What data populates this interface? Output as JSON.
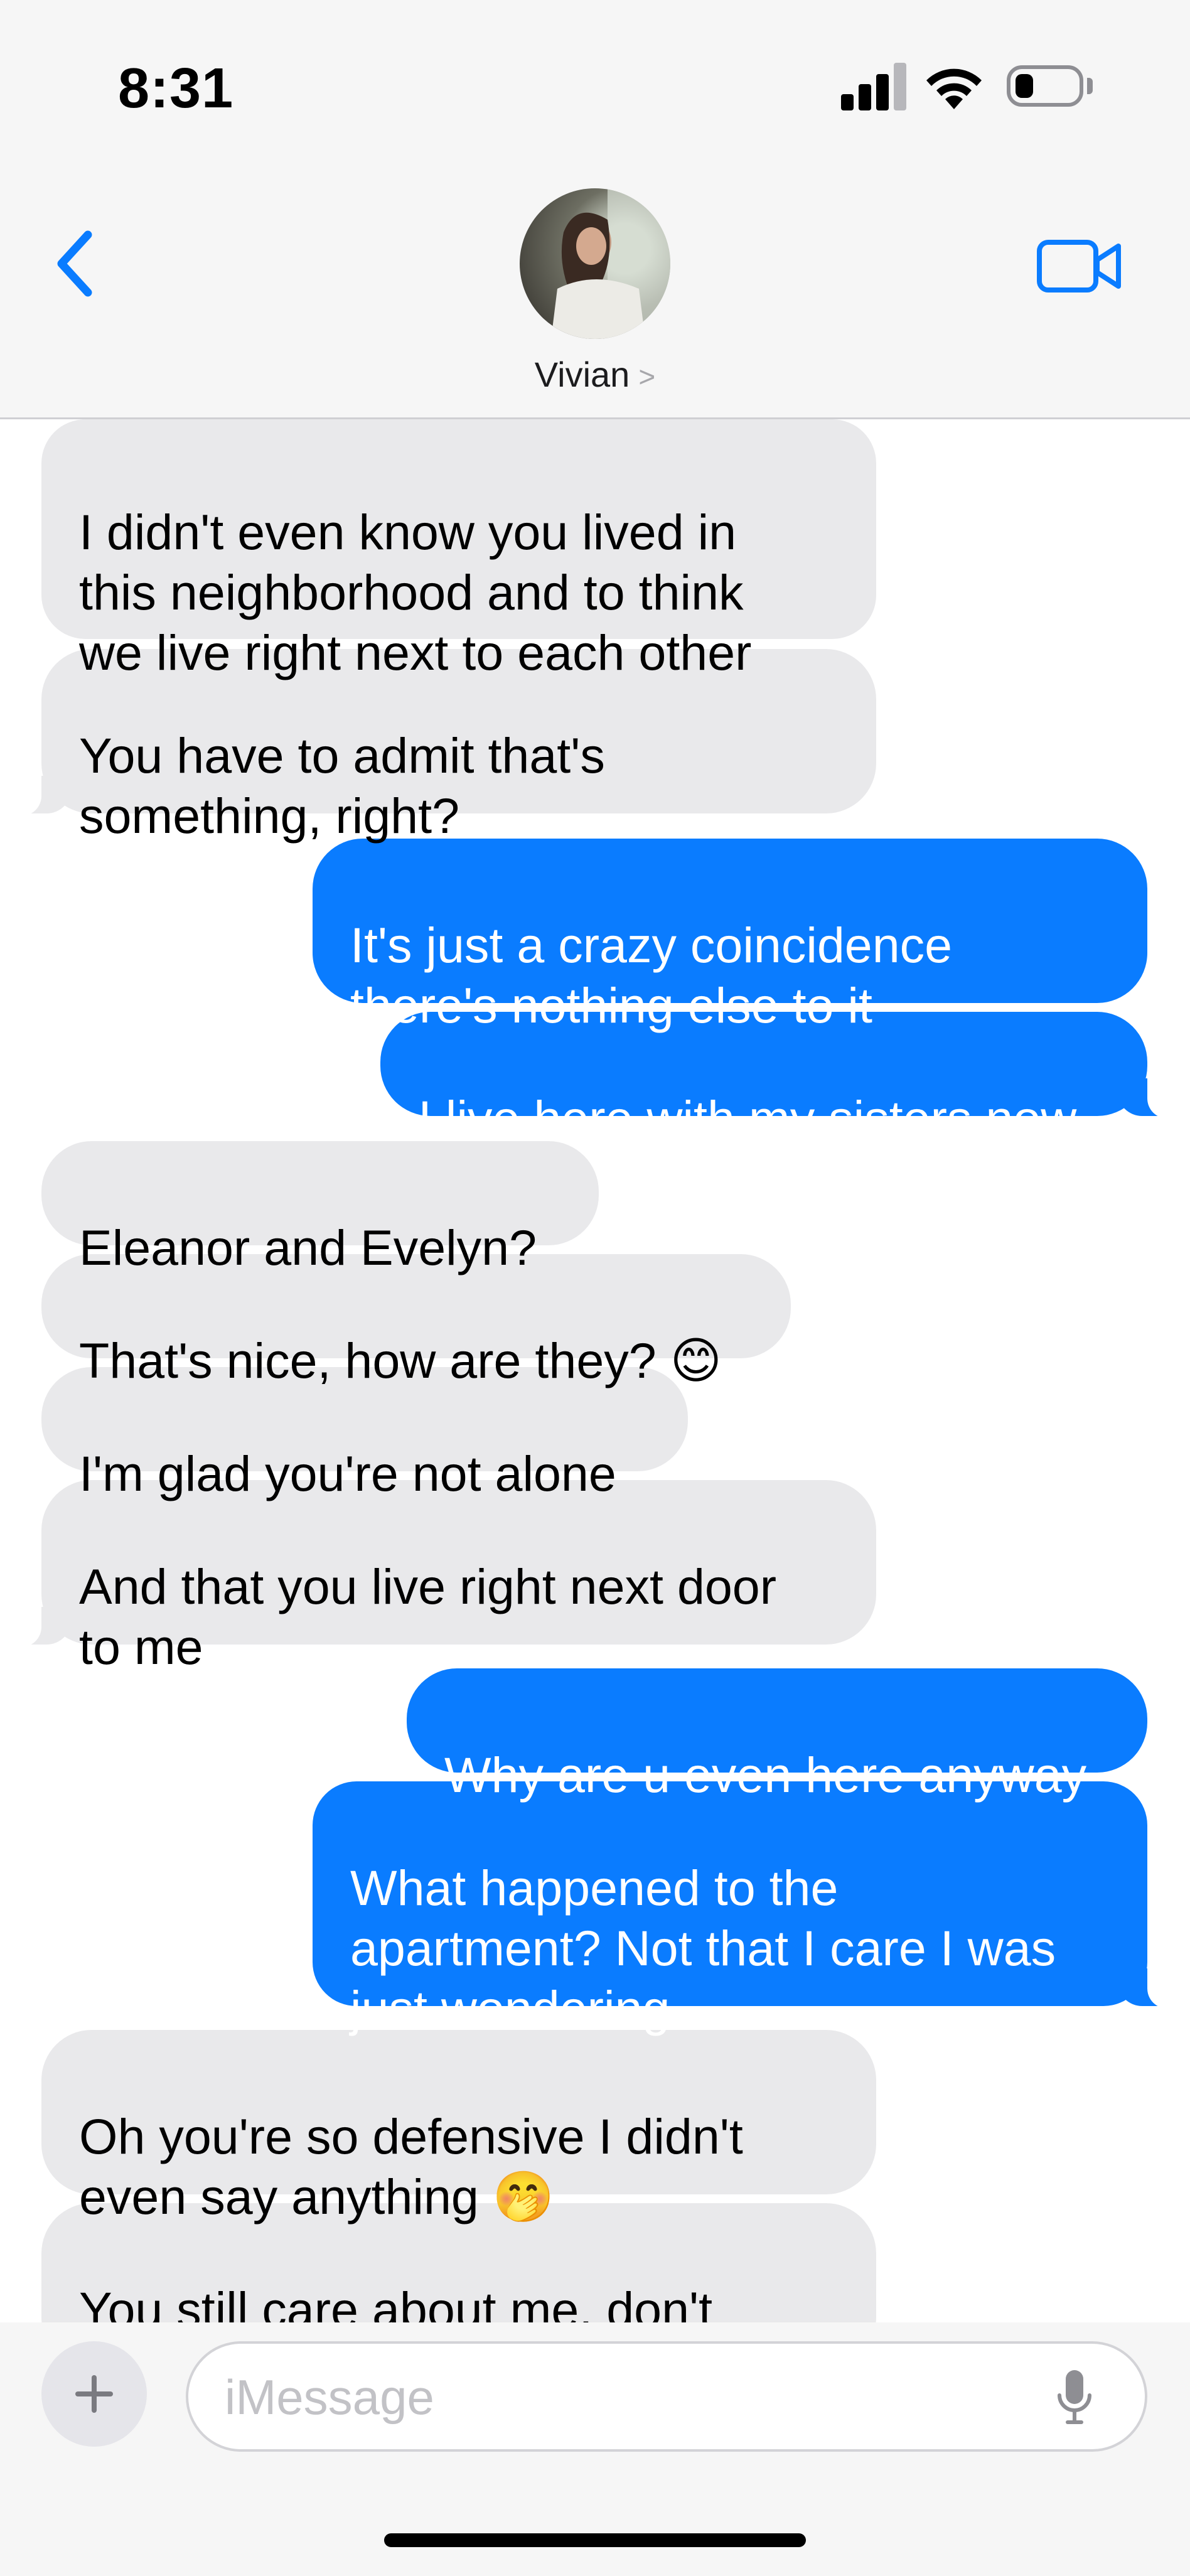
{
  "status_bar": {
    "time": "8:31",
    "signal_icon": "cellular-signal-icon",
    "wifi_icon": "wifi-icon",
    "battery_icon": "battery-low-icon",
    "battery_level": 0.2
  },
  "header": {
    "back_icon": "chevron-left-icon",
    "contact_name": "Vivian",
    "contact_chevron": ">",
    "video_icon": "video-camera-icon",
    "accent_color": "#0a7cff"
  },
  "messages": [
    {
      "from": "them",
      "text": "I didn't even know you lived in\nthis neighborhood and to think\nwe live right next to each other"
    },
    {
      "from": "them",
      "text": "You have to admit that's\nsomething, right?"
    },
    {
      "from": "me",
      "text": "It's just a crazy coincidence\nthere's nothing else to it"
    },
    {
      "from": "me",
      "text": "I live here with my sisters now"
    },
    {
      "from": "them",
      "text": "Eleanor and Evelyn?"
    },
    {
      "from": "them",
      "text": "That's nice, how are they? 😊"
    },
    {
      "from": "them",
      "text": "I'm glad you're not alone"
    },
    {
      "from": "them",
      "text": "And that you live right next door\nto me"
    },
    {
      "from": "me",
      "text": "Why are u even here anyway"
    },
    {
      "from": "me",
      "text": "What happened to the\napartment? Not that I care I was\njust wondering"
    },
    {
      "from": "them",
      "text": "Oh you're so defensive I didn't\neven say anything 🤭"
    },
    {
      "from": "them",
      "text": "You still care about me, don't\nyou? 👀"
    }
  ],
  "colors": {
    "incoming_bubble": "#e9e9eb",
    "outgoing_bubble": "#0a7cff"
  },
  "composer": {
    "plus_icon": "plus-icon",
    "placeholder": "iMessage",
    "value": "",
    "mic_icon": "microphone-icon"
  }
}
